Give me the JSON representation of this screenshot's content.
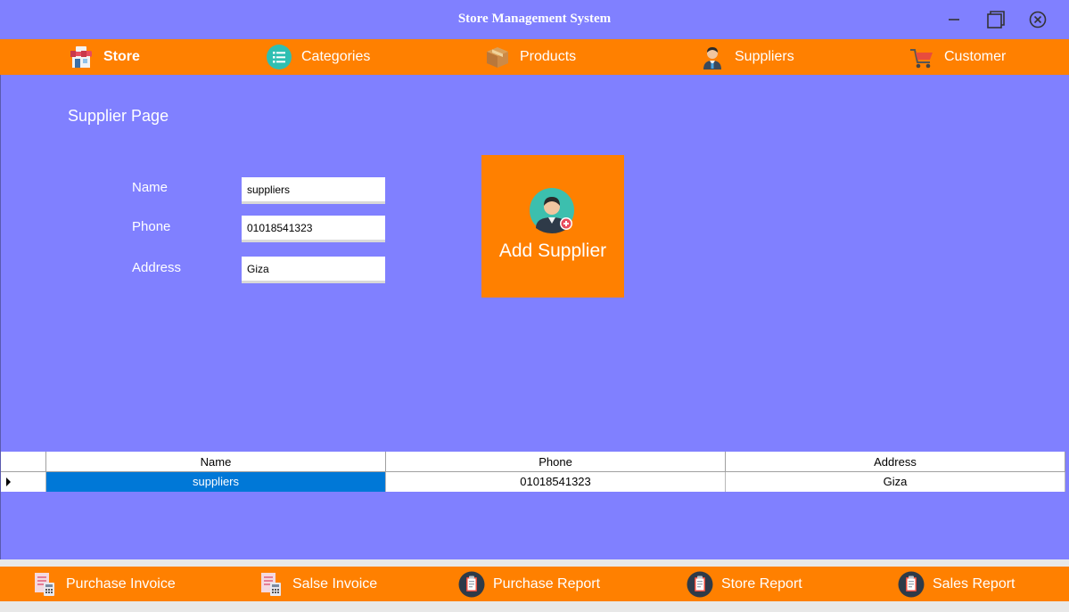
{
  "window": {
    "title": "Store Management System"
  },
  "topnav": {
    "items": [
      {
        "label": "Store",
        "icon": "store-icon"
      },
      {
        "label": "Categories",
        "icon": "list-icon"
      },
      {
        "label": "Products",
        "icon": "box-icon"
      },
      {
        "label": "Suppliers",
        "icon": "supplier-person-icon"
      },
      {
        "label": "Customer",
        "icon": "shopping-cart-icon"
      }
    ]
  },
  "page": {
    "title": "Supplier Page"
  },
  "form": {
    "name_label": "Name",
    "phone_label": "Phone",
    "address_label": "Address",
    "name_value": "suppliers",
    "phone_value": "01018541323",
    "address_value": "Giza"
  },
  "add_button": {
    "label": "Add Supplier",
    "icon": "add-user-icon"
  },
  "table": {
    "columns": [
      "Name",
      "Phone",
      "Address"
    ],
    "rows": [
      {
        "name": "suppliers",
        "phone": "01018541323",
        "address": "Giza",
        "selected": true
      }
    ]
  },
  "bottomnav": {
    "items": [
      {
        "label": "Purchase Invoice",
        "icon": "invoice-calculator-icon"
      },
      {
        "label": "Salse Invoice",
        "icon": "invoice-calculator-icon"
      },
      {
        "label": "Purchase Report",
        "icon": "clipboard-icon"
      },
      {
        "label": "Store Report",
        "icon": "clipboard-icon"
      },
      {
        "label": "Sales Report",
        "icon": "clipboard-icon"
      }
    ]
  },
  "colors": {
    "background": "#8080ff",
    "accent": "#ff8000",
    "selection": "#0078d7"
  }
}
